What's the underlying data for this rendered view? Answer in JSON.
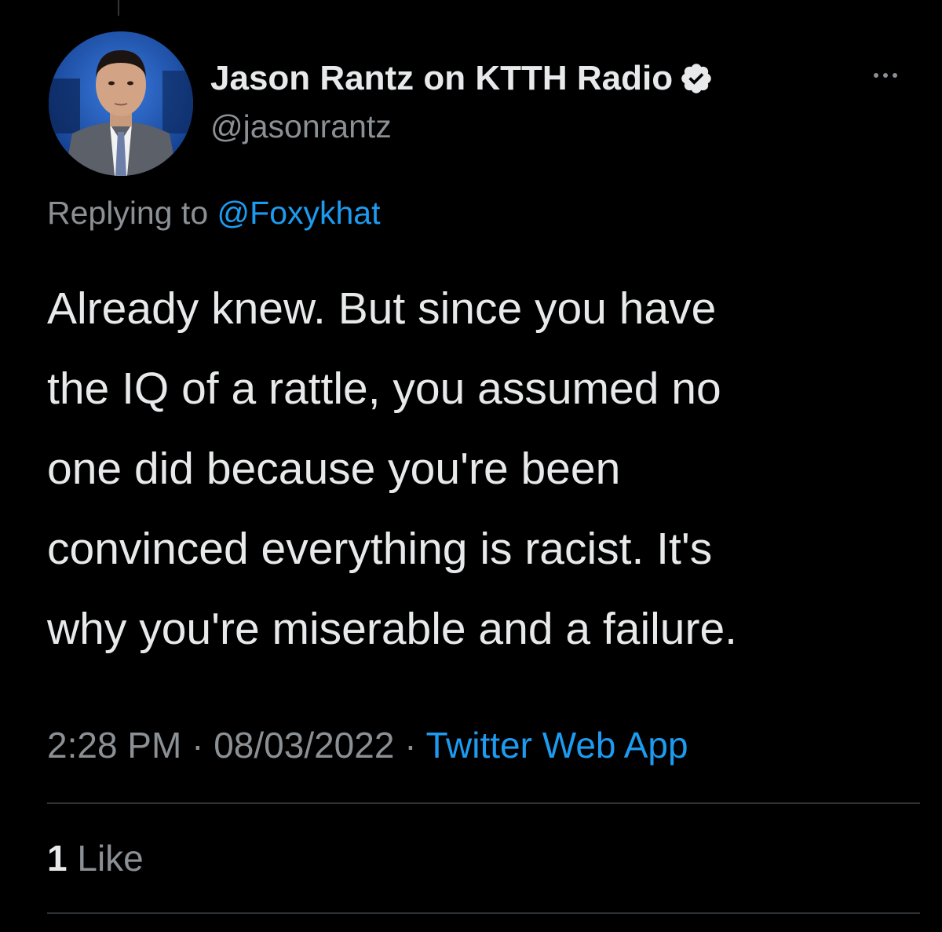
{
  "author": {
    "display_name": "Jason Rantz on KTTH Radio",
    "handle": "@jasonrantz",
    "verified": true,
    "verified_icon": "verified-badge-icon"
  },
  "reply": {
    "prefix": "Replying to",
    "mention": "@Foxykhat"
  },
  "tweet": {
    "lines": [
      "Already knew. But since you have",
      "the IQ of a rattle, you assumed no",
      "one did because you're been",
      "convinced everything is racist. It's",
      "why you're miserable and a failure."
    ]
  },
  "meta": {
    "time": "2:28 PM",
    "separator": "·",
    "date": "08/03/2022",
    "source": "Twitter Web App"
  },
  "engagement": {
    "like_count": "1",
    "like_label": "Like"
  },
  "colors": {
    "background": "#000000",
    "text": "#e7e9ea",
    "secondary": "#8b9095",
    "link": "#1d9bf0",
    "divider": "#2f3336"
  }
}
